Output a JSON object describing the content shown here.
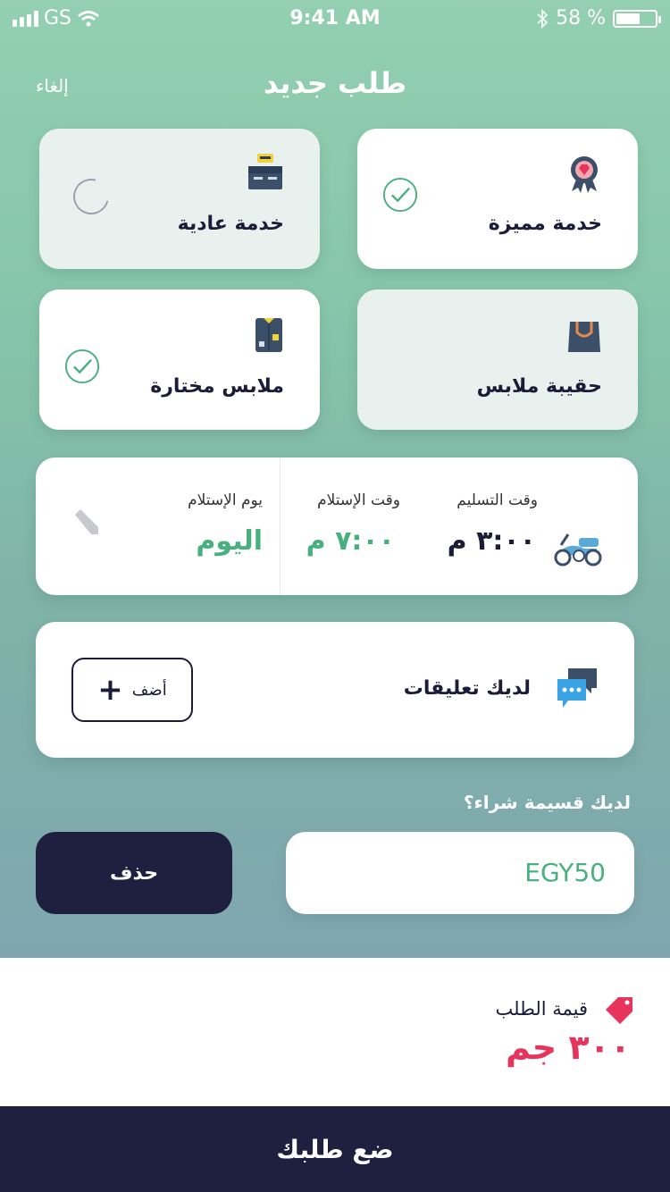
{
  "status_bar": {
    "carrier": "GS",
    "time": "9:41 AM",
    "battery": "58 %"
  },
  "header": {
    "title": "طلب جديد",
    "cancel_label": "إلغاء"
  },
  "services": {
    "regular": {
      "label": "خدمة عادية",
      "selected": false,
      "icon": "delivery-box-icon"
    },
    "premium": {
      "label": "خدمة مميزة",
      "selected": true,
      "icon": "award-badge-icon"
    },
    "selected_clothes": {
      "label": "ملابس مختارة",
      "selected": true,
      "icon": "shirt-icon"
    },
    "clothes_bag": {
      "label": "حقيبة ملابس",
      "selected": false,
      "icon": "shopping-bag-icon"
    }
  },
  "schedule": {
    "delivery_time_label": "وقت التسليم",
    "delivery_time_value": "٣:٠٠ م",
    "pickup_time_label": "وقت الإستلام",
    "pickup_time_value": "٧:٠٠ م",
    "pickup_day_label": "يوم الإستلام",
    "pickup_day_value": "اليوم"
  },
  "comments": {
    "label": "لديك تعليقات",
    "add_label": "أضف"
  },
  "coupon": {
    "question": "لديك قسيمة شراء؟",
    "value": "EGY50",
    "delete_label": "حذف"
  },
  "total": {
    "label": "قيمة الطلب",
    "value": "٣٠٠ جم"
  },
  "submit": {
    "label": "ضع طلبك"
  },
  "colors": {
    "primary_dark": "#1f1f3f",
    "accent_green": "#48b07f",
    "price_red": "#e8345c"
  }
}
